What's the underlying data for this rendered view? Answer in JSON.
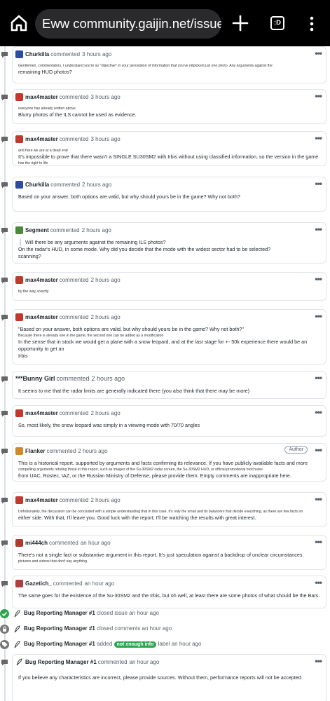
{
  "browser": {
    "url": "Eww community.gaijin.net/issues/",
    "tab_count_label": ":D"
  },
  "comments": [
    {
      "author": "Churkilla",
      "verb": "commented",
      "time": "3 hours ago",
      "lines": [
        {
          "text": "Gentlemen, commentators, I understand you're so \"objective\" in your perception of information that you've nitpicked just one photo. Any arguments against the",
          "size": "small"
        },
        {
          "text": "remaining HUD photos?",
          "size": "normal"
        }
      ]
    },
    {
      "author": "max4master",
      "verb": "commented",
      "time": "3 hours ago",
      "lines": [
        {
          "text": "everyone has already written above",
          "size": "small"
        },
        {
          "text": "Blurry photos of the ILS cannot be used as evidence.",
          "size": "normal"
        }
      ]
    },
    {
      "author": "max4master",
      "verb": "commented",
      "time": "3 hours ago",
      "lines": [
        {
          "text": "and here we are at a dead end",
          "size": "small"
        },
        {
          "text": "It's impossible to prove that there wasn't a SINGLE SU30SM2 with Irbis without using classified information, so the version in the game",
          "size": "normal"
        },
        {
          "text": "has the right to life",
          "size": "small"
        }
      ]
    },
    {
      "author": "Churkilla",
      "verb": "commented",
      "time": "2 hours ago",
      "lines": [
        {
          "text": "Based on your answer, both options are valid, but why should yours be in the game? Why not both?",
          "size": "normal"
        }
      ]
    },
    {
      "author": "Segment",
      "verb": "commented",
      "time": "2 hours ago",
      "quote": "Will there be any arguments against the remaining ILS photos?",
      "lines": [
        {
          "text": "On the radar's HUD, in some mode. Why did you decide that the mode with the widest sector had to be selected?",
          "size": "normal"
        },
        {
          "text": "scanning?",
          "size": "normal"
        }
      ]
    },
    {
      "author": "max4master",
      "verb": "commented",
      "time": "2 hours ago",
      "lines": [
        {
          "text": "by the way, exactly",
          "size": "small"
        }
      ]
    },
    {
      "author": "max4master",
      "verb": "commented",
      "time": "2 hours ago",
      "lines": [
        {
          "text": "\"Based on your answer, both options are valid, but why should yours be in the game? Why not both?\"",
          "size": "normal"
        },
        {
          "text": "Because there is already one in the game, the second one can be added as a modification",
          "size": "small"
        },
        {
          "text": "In the sense that in stock we would get a plane with a snow leopard, and at the last stage for +- 50k experience there would be an opportunity to get an",
          "size": "normal"
        },
        {
          "text": "Irbis",
          "size": "normal"
        }
      ]
    },
    {
      "author": "***Bunny Girl",
      "verb": "commented",
      "time": "2 hours ago",
      "lines": [
        {
          "text": "It seems to me that the radar limits are generally indicated there (you also think that there may be more)",
          "size": "normal"
        }
      ]
    },
    {
      "author": "max4master",
      "verb": "commented",
      "time": "2 hours ago",
      "lines": [
        {
          "text": "So, most likely, the snow leopard was simply in a viewing mode with 70/70 angles",
          "size": "normal"
        }
      ]
    },
    {
      "author": "Flanker",
      "verb": "commented",
      "time": "2 hours ago",
      "badge": "Author",
      "lines": [
        {
          "text": "This is a historical report, supported by arguments and facts confirming its relevance. If you have publicly available facts and more",
          "size": "normal"
        },
        {
          "text": "compelling arguments refuting those in this report, such as images of the Su-30SM2 radar screen, the Su-30SM2 HUD, or official promotional brochures",
          "size": "small"
        },
        {
          "text": "from UAC, Rostec, IAZ, or the Russian Ministry of Defense, please provide them. Empty comments are inappropriate here.",
          "size": "normal"
        }
      ]
    },
    {
      "author": "max4master",
      "verb": "commented",
      "time": "2 hours ago",
      "lines": [
        {
          "text": "Unfortunately, the discussion can be concluded with a simple understanding that in this case, it's only the small and its balancers that decide everything, as there are few facts on",
          "size": "small"
        },
        {
          "text": "either side. With that, I'll leave you. Good luck with the report; I'll be watching the results with great interest.",
          "size": "normal"
        }
      ]
    },
    {
      "author": "mi444ch",
      "verb": "commented",
      "time": "an hour ago",
      "lines": [
        {
          "text": "There's not a single fact or substantive argument in this report. It's just speculation against a backdrop of unclear circumstances.",
          "size": "normal"
        },
        {
          "text": "pictures and videos that don't say anything.",
          "size": "small"
        }
      ]
    },
    {
      "author": "Gazetich_",
      "verb": "commented",
      "time": "an hour ago",
      "lines": [
        {
          "text": "The same goes for the existence of the Su-30SM2 and the Irbis, but oh well, at least there are some photos of what should be the Bars.",
          "size": "normal"
        }
      ]
    }
  ],
  "events": [
    {
      "author": "Bug Reporting Manager #1",
      "text": "closed issue an hour ago"
    },
    {
      "author": "Bug Reporting Manager #1",
      "text": "closed comments an hour ago"
    },
    {
      "author": "Bug Reporting Manager #1",
      "text_before": "added",
      "label": "not enough info",
      "text_after": "label an hour ago"
    }
  ],
  "final_comment": {
    "author": "Bug Reporting Manager #1",
    "verb": "commented",
    "time": "an hour ago",
    "text": "If you believe any characteristics are incorrect, please provide sources. Without them, performance reports will not be accepted."
  },
  "colors": {
    "topbar": "#000000",
    "urlbar": "#2a2a2d",
    "closed_icon": "#2ea44f",
    "label": "#2ea44f",
    "border": "#e1e4e8"
  }
}
